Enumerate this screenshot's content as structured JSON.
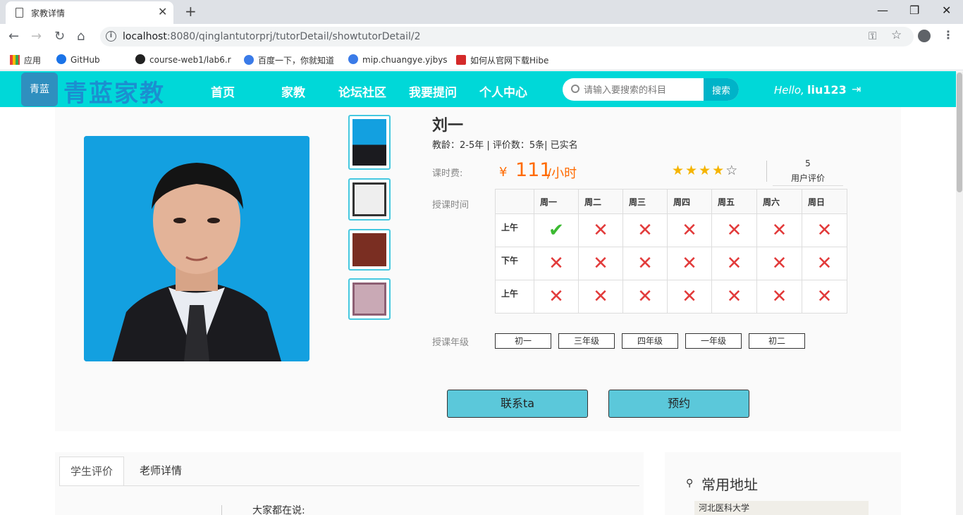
{
  "browser": {
    "tab_title": "家教详情",
    "url_host": "localhost",
    "url_rest": ":8080/qinglantutorprj/tutorDetail/showtutorDetail/2",
    "bookmarks": [
      "应用",
      "GitHub",
      "course-web1/lab6.r",
      "百度一下，你就知道",
      "mip.chuangye.yjbys",
      "如何从官网下载Hibe"
    ]
  },
  "site": {
    "logo_mark": "青蓝",
    "logo_text": "青蓝家教",
    "nav": [
      "首页",
      "家教",
      "论坛社区",
      "我要提问",
      "个人中心"
    ],
    "search_placeholder": "请输入要搜索的科目",
    "search_button": "搜索",
    "hello": "Hello,",
    "username": "liu123"
  },
  "tutor": {
    "name": "刘一",
    "meta": "教龄：2-5年  | 评价数：5条|   已实名",
    "fee_label": "课时费:",
    "fee_yen": "¥",
    "fee_amount": "111",
    "fee_unit": "/小时",
    "rating": 4,
    "rating_max": 5,
    "rating_count": "5",
    "rating_label": "用户评价"
  },
  "schedule": {
    "label": "授课时间",
    "days": [
      "周一",
      "周二",
      "周三",
      "周四",
      "周五",
      "周六",
      "周日"
    ],
    "rows": [
      {
        "label": "上午",
        "available": [
          true,
          false,
          false,
          false,
          false,
          false,
          false
        ]
      },
      {
        "label": "下午",
        "available": [
          false,
          false,
          false,
          false,
          false,
          false,
          false
        ]
      },
      {
        "label": "上午",
        "available": [
          false,
          false,
          false,
          false,
          false,
          false,
          false
        ]
      }
    ]
  },
  "grades": {
    "label": "授课年级",
    "items": [
      "初一",
      "三年级",
      "四年级",
      "一年级",
      "初二"
    ]
  },
  "actions": {
    "contact": "联系ta",
    "book": "预约"
  },
  "lower": {
    "tabs": [
      "学生评价",
      "老师详情"
    ],
    "review_title": "大家都在说:",
    "address_title": "常用地址",
    "map_label": "河北医科大学"
  },
  "colors": {
    "header": "#00d8d8",
    "accent_price": "#ff6a00",
    "button": "#5bc8da",
    "cross": "#e23b3b",
    "check": "#3cba32"
  }
}
